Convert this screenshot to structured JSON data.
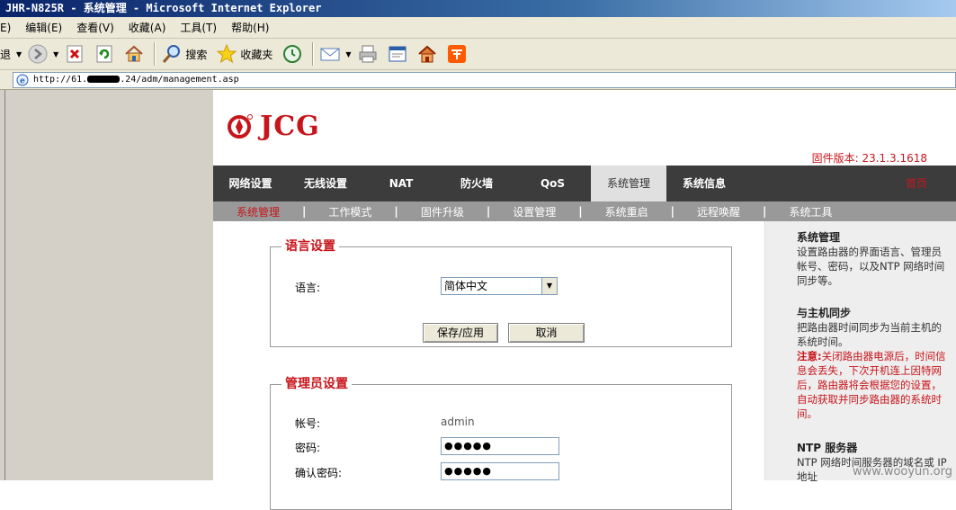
{
  "window": {
    "title": "JHR-N825R - 系统管理 - Microsoft Internet Explorer"
  },
  "menubar": {
    "items": [
      "E)",
      "编辑(E)",
      "查看(V)",
      "收藏(A)",
      "工具(T)",
      "帮助(H)"
    ]
  },
  "toolbar": {
    "back_label": "退",
    "search_label": "搜索",
    "favorites_label": "收藏夹"
  },
  "address": {
    "url_prefix": "http://61.",
    "url_suffix": ".24/adm/management.asp"
  },
  "page": {
    "logo_text": "JCG",
    "firmware_version": "固件版本: 23.1.3.1618",
    "nav": [
      {
        "label": "网络设置",
        "active": false
      },
      {
        "label": "无线设置",
        "active": false
      },
      {
        "label": "NAT",
        "active": false
      },
      {
        "label": "防火墙",
        "active": false
      },
      {
        "label": "QoS",
        "active": false
      },
      {
        "label": "系统管理",
        "active": true
      },
      {
        "label": "系统信息",
        "active": false
      }
    ],
    "home_label": "首页",
    "subnav": [
      {
        "label": "系统管理",
        "active": true
      },
      {
        "label": "工作模式",
        "active": false
      },
      {
        "label": "固件升级",
        "active": false
      },
      {
        "label": "设置管理",
        "active": false
      },
      {
        "label": "系统重启",
        "active": false
      },
      {
        "label": "远程唤醒",
        "active": false
      },
      {
        "label": "系统工具",
        "active": false
      }
    ],
    "subnav_separator": "|",
    "language_section": {
      "legend": "语言设置",
      "language_label": "语言:",
      "language_value": "简体中文",
      "save_label": "保存/应用",
      "cancel_label": "取消"
    },
    "admin_section": {
      "legend": "管理员设置",
      "account_label": "帐号:",
      "account_value": "admin",
      "password_label": "密码:",
      "password_value": "●●●●●",
      "confirm_label": "确认密码:",
      "confirm_value": "●●●●●"
    },
    "help": {
      "title1": "系统管理",
      "text1": "设置路由器的界面语言、管理员帐号、密码，以及NTP 网络时间同步等。",
      "title2": "与主机同步",
      "text2": "把路由器时间同步为当前主机的系统时间。",
      "note_label": "注意:",
      "note_text": "关闭路由器电源后，时间信息会丢失，下次开机连上因特网后，路由器将会根据您的设置，自动获取并同步路由器的系统时间。",
      "title3": "NTP 服务器",
      "text3": "NTP 网络时间服务器的域名或 IP 地址"
    }
  },
  "watermark": "www.wooyun.org",
  "colors": {
    "brand_red": "#c8151b",
    "nav_bg": "#3c3c3c",
    "subnav_bg": "#999999"
  }
}
